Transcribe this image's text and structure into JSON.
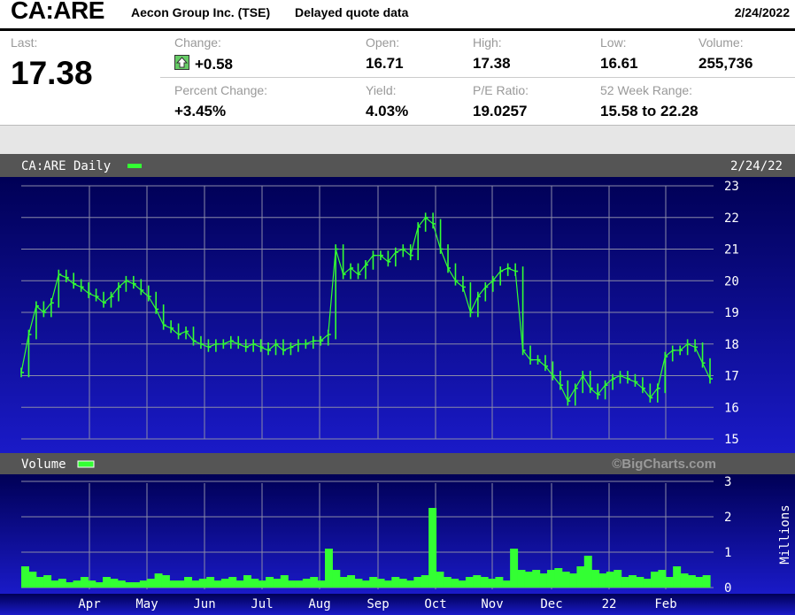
{
  "header": {
    "symbol": "CA:ARE",
    "company": "Aecon Group Inc. (TSE)",
    "delayed": "Delayed quote data",
    "date": "2/24/2022"
  },
  "quote": {
    "last_label": "Last:",
    "last": "17.38",
    "change_label": "Change:",
    "change": "+0.58",
    "open_label": "Open:",
    "open": "16.71",
    "high_label": "High:",
    "high": "17.38",
    "low_label": "Low:",
    "low": "16.61",
    "volume_label": "Volume:",
    "volume": "255,736",
    "pct_label": "Percent Change:",
    "pct": "+3.45%",
    "yield_label": "Yield:",
    "yield": "4.03%",
    "pe_label": "P/E Ratio:",
    "pe": "19.0257",
    "range_label": "52 Week Range:",
    "range": "15.58 to 22.28"
  },
  "colors": {
    "series": "#33ff33",
    "background": "#0a0a7a",
    "grid": "#8a8aa8",
    "bar": "#555555"
  },
  "chart_data": [
    {
      "type": "line",
      "title": "CA:ARE Daily",
      "date_label": "2/24/22",
      "y_ticks": [
        "23",
        "22",
        "21",
        "20",
        "19",
        "18",
        "17",
        "16",
        "15"
      ],
      "ylim": [
        15,
        23
      ],
      "x_ticks": [
        "Apr",
        "May",
        "Jun",
        "Jul",
        "Aug",
        "Sep",
        "Oct",
        "Nov",
        "Dec",
        "22",
        "Feb"
      ],
      "grid": true,
      "series": [
        {
          "values": [
            17.1,
            18.3,
            19.2,
            19.0,
            19.3,
            20.2,
            20.1,
            19.9,
            19.8,
            19.6,
            19.5,
            19.3,
            19.5,
            19.8,
            20.0,
            19.9,
            19.7,
            19.5,
            19.1,
            18.6,
            18.5,
            18.3,
            18.4,
            18.1,
            18.0,
            17.9,
            18.0,
            18.0,
            18.1,
            18.0,
            17.9,
            18.0,
            17.9,
            17.8,
            18.0,
            17.8,
            17.9,
            18.0,
            18.0,
            18.1,
            18.1,
            18.3,
            21.0,
            20.2,
            20.4,
            20.2,
            20.5,
            20.8,
            20.8,
            20.6,
            20.9,
            21.0,
            20.8,
            21.7,
            22.0,
            21.8,
            21.0,
            20.4,
            20.0,
            19.8,
            19.0,
            19.5,
            19.8,
            20.0,
            20.3,
            20.4,
            20.3,
            17.8,
            17.5,
            17.5,
            17.3,
            17.0,
            16.7,
            16.2,
            16.6,
            17.0,
            16.6,
            16.4,
            16.7,
            16.9,
            17.0,
            16.9,
            16.8,
            16.6,
            16.3,
            16.6,
            17.6,
            17.8,
            17.8,
            18.0,
            17.9,
            17.4,
            16.9
          ],
          "labels": []
        }
      ]
    },
    {
      "type": "bar",
      "title": "Volume",
      "watermark": "©BigCharts.com",
      "y_ticks": [
        "3",
        "2",
        "1",
        "0"
      ],
      "ylim": [
        0,
        3
      ],
      "ylabel": "Millions",
      "x_ticks": [
        "Apr",
        "May",
        "Jun",
        "Jul",
        "Aug",
        "Sep",
        "Oct",
        "Nov",
        "Dec",
        "22",
        "Feb"
      ],
      "series": [
        {
          "values": [
            0.6,
            0.45,
            0.3,
            0.35,
            0.2,
            0.25,
            0.15,
            0.2,
            0.3,
            0.2,
            0.15,
            0.3,
            0.25,
            0.2,
            0.15,
            0.15,
            0.2,
            0.25,
            0.4,
            0.35,
            0.2,
            0.2,
            0.3,
            0.2,
            0.25,
            0.3,
            0.2,
            0.25,
            0.3,
            0.2,
            0.35,
            0.25,
            0.2,
            0.3,
            0.25,
            0.35,
            0.2,
            0.2,
            0.25,
            0.3,
            0.2,
            1.1,
            0.5,
            0.3,
            0.35,
            0.25,
            0.2,
            0.3,
            0.25,
            0.2,
            0.3,
            0.25,
            0.2,
            0.3,
            0.35,
            2.25,
            0.45,
            0.3,
            0.25,
            0.2,
            0.3,
            0.35,
            0.3,
            0.25,
            0.3,
            0.2,
            1.1,
            0.5,
            0.45,
            0.5,
            0.4,
            0.5,
            0.55,
            0.45,
            0.4,
            0.6,
            0.9,
            0.5,
            0.4,
            0.45,
            0.5,
            0.3,
            0.35,
            0.3,
            0.25,
            0.45,
            0.5,
            0.3,
            0.6,
            0.4,
            0.35,
            0.3,
            0.35
          ],
          "labels": []
        }
      ]
    }
  ]
}
